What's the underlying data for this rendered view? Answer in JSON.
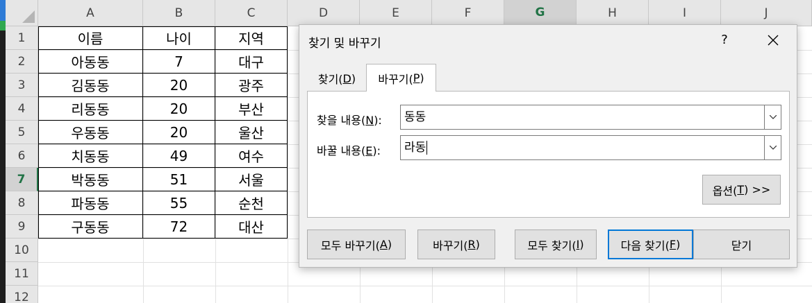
{
  "columns": [
    "A",
    "B",
    "C",
    "D",
    "E",
    "F",
    "G",
    "H",
    "I",
    "J"
  ],
  "selected_column": "G",
  "rows": [
    "1",
    "2",
    "3",
    "4",
    "5",
    "6",
    "7",
    "8",
    "9",
    "10",
    "11",
    "12"
  ],
  "selected_row": "7",
  "table": [
    [
      "이름",
      "나이",
      "지역"
    ],
    [
      "아동동",
      "7",
      "대구"
    ],
    [
      "김동동",
      "20",
      "광주"
    ],
    [
      "리동동",
      "20",
      "부산"
    ],
    [
      "우동동",
      "20",
      "울산"
    ],
    [
      "치동동",
      "49",
      "여수"
    ],
    [
      "박동동",
      "51",
      "서울"
    ],
    [
      "파동동",
      "55",
      "순천"
    ],
    [
      "구동동",
      "72",
      "대산"
    ]
  ],
  "dialog": {
    "title": "찾기 및 바꾸기",
    "help": "?",
    "tabs": {
      "find": {
        "label": "찾기(",
        "key": "D",
        "close": ")"
      },
      "replace": {
        "label": "바꾸기(",
        "key": "P",
        "close": ")"
      }
    },
    "find_label": {
      "text": "찾을 내용(",
      "key": "N",
      "close": "):"
    },
    "find_value": "동동",
    "replace_label": {
      "text": "바꿀 내용(",
      "key": "E",
      "close": "):"
    },
    "replace_value": "라동",
    "options_button": {
      "text": "옵션(",
      "key": "T",
      "close": ") >>"
    },
    "buttons": {
      "replace_all": {
        "text": "모두 바꾸기(",
        "key": "A",
        "close": ")"
      },
      "replace": {
        "text": "바꾸기(",
        "key": "R",
        "close": ")"
      },
      "find_all": {
        "text": "모두 찾기(",
        "key": "I",
        "close": ")"
      },
      "find_next": {
        "text": "다음 찾기(",
        "key": "F",
        "close": ")"
      },
      "close": "닫기"
    }
  }
}
